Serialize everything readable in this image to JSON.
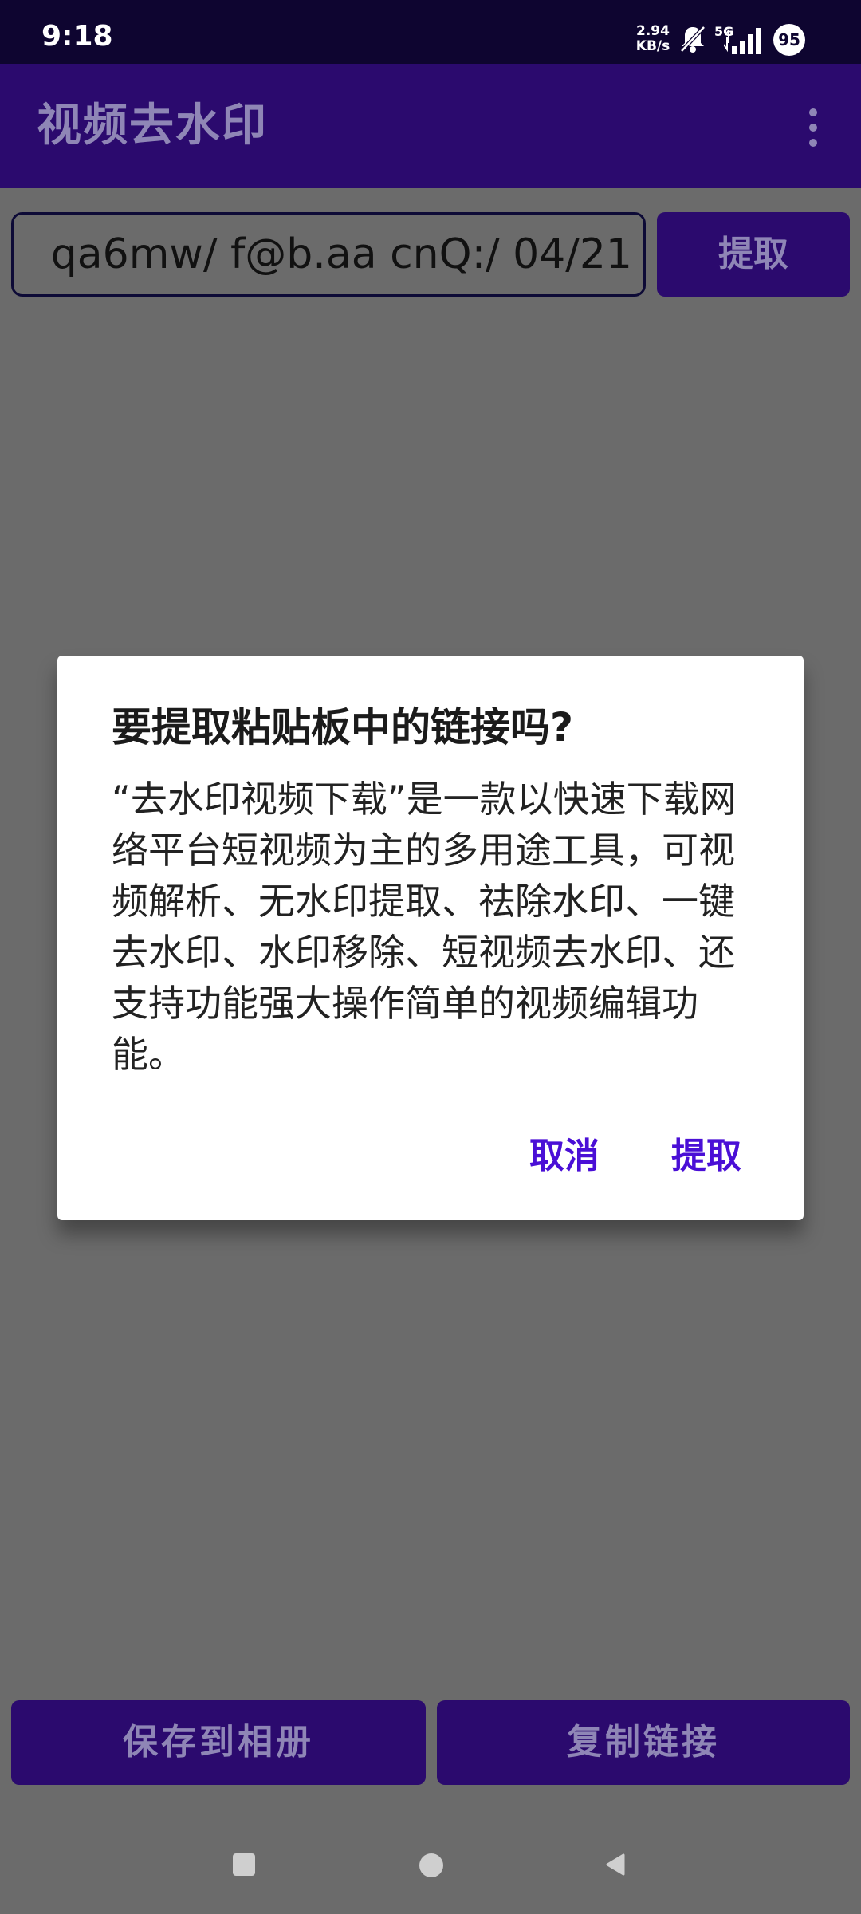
{
  "status_bar": {
    "time": "9:18",
    "net_speed_value": "2.94",
    "net_speed_unit": "KB/s",
    "network_label": "5G",
    "battery_level": "95",
    "icons": [
      "mute-icon",
      "signal-icon",
      "battery-icon"
    ]
  },
  "app_bar": {
    "title": "视频去水印",
    "menu_icon": "overflow-menu-icon"
  },
  "input": {
    "value": "qa6mw/ f@b.aa cnQ:/ 04/21"
  },
  "buttons": {
    "extract": "提取",
    "save": "保存到相册",
    "copy_link": "复制链接"
  },
  "dialog": {
    "title": "要提取粘贴板中的链接吗?",
    "message": "“去水印视频下载”是一款以快速下载网络平台短视频为主的多用途工具，可视频解析、无水印提取、祛除水印、一键去水印、水印移除、短视频去水印、还支持功能强大操作简单的视频编辑功能。",
    "cancel": "取消",
    "confirm": "提取"
  },
  "colors": {
    "status_bar": "#0e0530",
    "app_bar": "#2b0a6e",
    "scrim": "#6b6b6b",
    "dialog_action": "#4a0fd6",
    "button_text": "#8f86b6"
  },
  "nav_bar": {
    "icons": [
      "recents-icon",
      "home-icon",
      "back-icon"
    ]
  }
}
